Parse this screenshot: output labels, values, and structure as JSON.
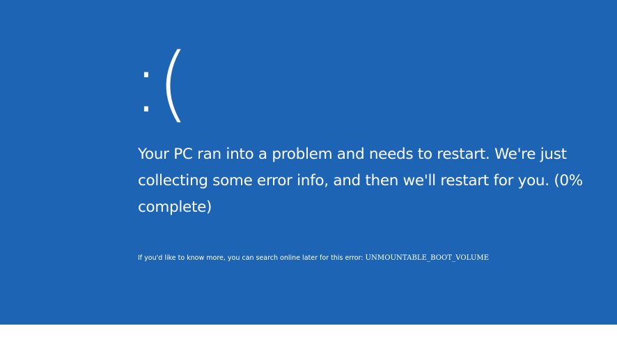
{
  "screen": {
    "background_color": "#1e64b4",
    "text_color": "#ffffff",
    "emoticon": ":(",
    "headline": "Your PC ran into a problem and needs to restart. We're just collecting some error info, and then we'll restart for you. (0% complete)",
    "info_text": "If you'd like to know more, you can search online later for this error: ",
    "stop_code": "UNMOUNTABLE_BOOT_VOLUME",
    "progress_percent": 0
  }
}
